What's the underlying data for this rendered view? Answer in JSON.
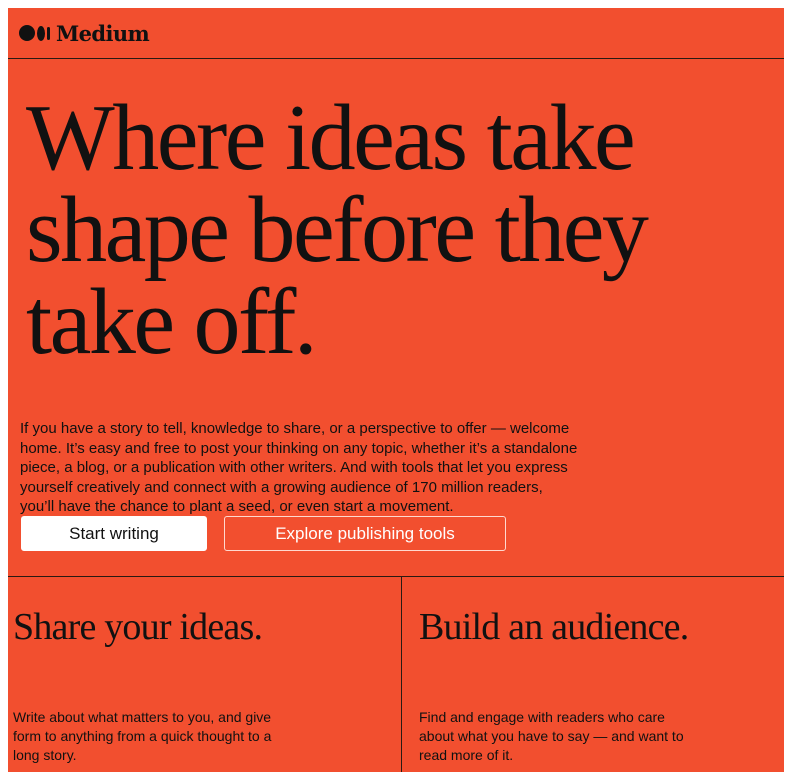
{
  "brand": {
    "name": "Medium",
    "icon": "medium-logo-icon",
    "background_color": "#f24f2f"
  },
  "hero": {
    "headline_lines": [
      "Where ideas take",
      "shape before they",
      "take off."
    ],
    "lead": "If you have a story to tell, knowledge to share, or a perspective to offer — welcome home. It’s easy and free to post your thinking on any topic, whether it’s a standalone piece, a blog, or a publication with other writers. And with tools that let you express yourself creatively and connect with a growing audience of 170 million readers, you’ll have the chance to plant a seed, or even start a movement."
  },
  "buttons": {
    "start_writing": "Start writing",
    "explore_tools": "Explore publishing tools"
  },
  "features": [
    {
      "title": "Share your ideas.",
      "body": "Write about what matters to you, and give form to anything from a quick thought to a long story."
    },
    {
      "title": "Build an audience.",
      "body": "Find and engage with readers who care about what you have to say — and want to read more of it."
    }
  ]
}
